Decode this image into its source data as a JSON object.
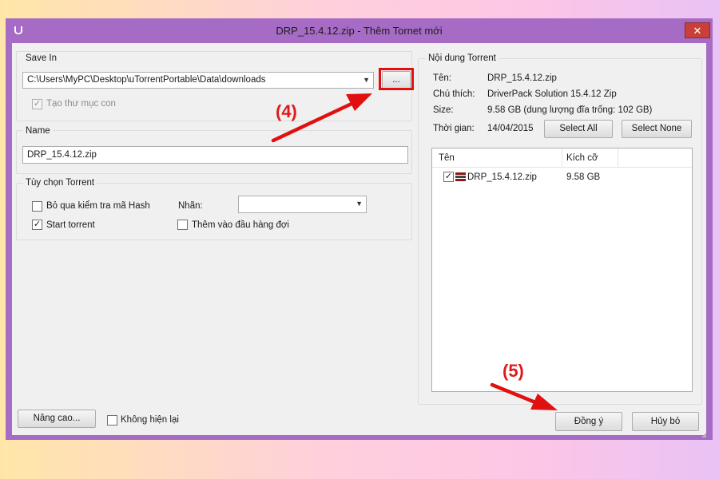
{
  "window": {
    "title": "DRP_15.4.12.zip - Thêm Tornet mới",
    "close_label": "✕"
  },
  "save_in": {
    "legend": "Save In",
    "path": "C:\\Users\\MyPC\\Desktop\\uTorrentPortable\\Data\\downloads",
    "browse_label": "...",
    "subfolder_label": "Tạo thư mục con",
    "subfolder_checked": true
  },
  "name_group": {
    "legend": "Name",
    "value": "DRP_15.4.12.zip"
  },
  "torrent_options": {
    "legend": "Tùy chọn Torrent",
    "skip_hash_label": "Bỏ qua kiểm tra mã Hash",
    "skip_hash_checked": false,
    "label_caption": "Nhãn:",
    "label_value": "",
    "start_torrent_label": "Start torrent",
    "start_torrent_checked": true,
    "queue_top_label": "Thêm vào đầu hàng đợi",
    "queue_top_checked": false
  },
  "torrent_content": {
    "legend": "Nội dung Torrent",
    "name_key": "Tên:",
    "name_val": "DRP_15.4.12.zip",
    "comment_key": "Chú thích:",
    "comment_val": "DriverPack Solution 15.4.12 Zip",
    "size_key": "Size:",
    "size_val": "9.58 GB (dung lượng đĩa trống: 102 GB)",
    "date_key": "Thời gian:",
    "date_val": "14/04/2015",
    "select_all": "Select All",
    "select_none": "Select None",
    "columns": [
      "Tên",
      "Kích cỡ"
    ],
    "files": [
      {
        "name": "DRP_15.4.12.zip",
        "size": "9.58 GB",
        "checked": true
      }
    ]
  },
  "footer": {
    "advanced_label": "Nâng cao...",
    "dont_show_label": "Không hiện lại",
    "dont_show_checked": false,
    "ok_label": "Đồng ý",
    "cancel_label": "Hủy bỏ"
  },
  "annotations": {
    "step4": "(4)",
    "step5": "(5)",
    "color": "#e01010"
  },
  "icons": {
    "app": "utorrent-icon",
    "file": "archive-file-icon",
    "dropdown": "chevron-down-icon"
  }
}
